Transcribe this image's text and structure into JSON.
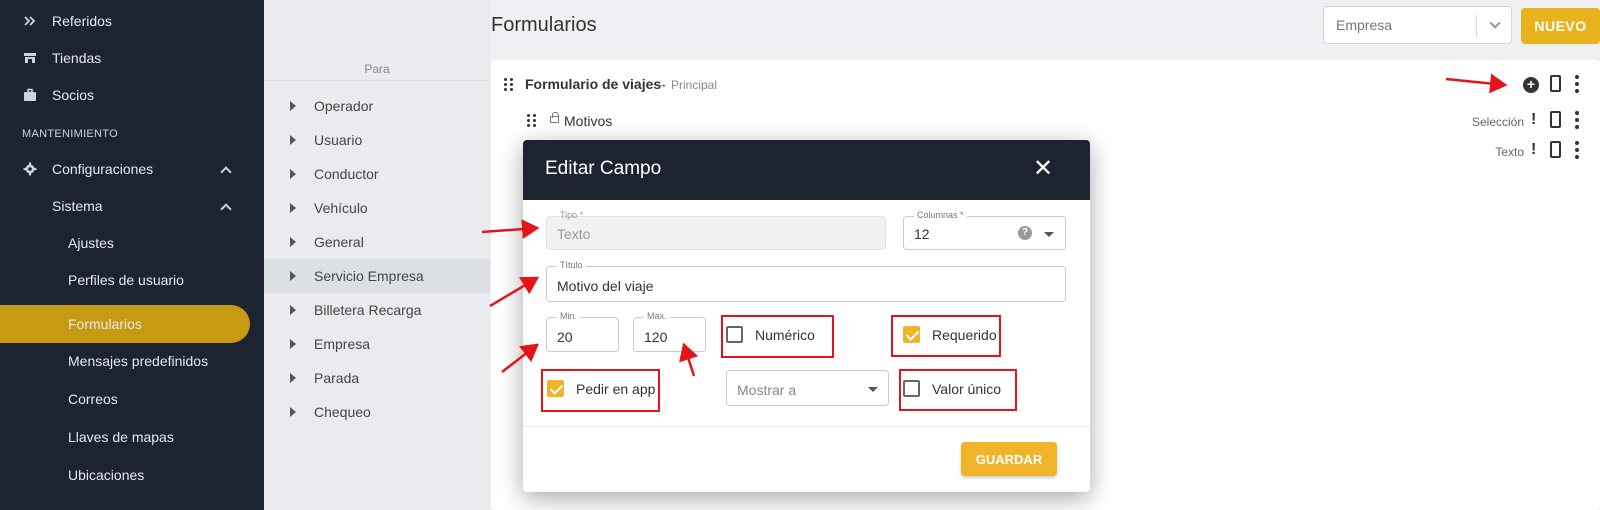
{
  "sidebar": {
    "items": [
      {
        "label": "Referidos",
        "icon": "referral-icon"
      },
      {
        "label": "Tiendas",
        "icon": "store-icon"
      },
      {
        "label": "Socios",
        "icon": "briefcase-icon"
      }
    ],
    "section_label": "MANTENIMIENTO",
    "configuraciones": "Configuraciones",
    "sistema": "Sistema",
    "sub_items": [
      "Ajustes",
      "Perfiles de usuario",
      "Formularios",
      "Mensajes predefinidos",
      "Correos",
      "Llaves de mapas",
      "Ubicaciones"
    ],
    "active": "Formularios",
    "accent_color": "#c79a14"
  },
  "tree": {
    "header": "Para",
    "items": [
      "Operador",
      "Usuario",
      "Conductor",
      "Vehículo",
      "General",
      "Servicio Empresa",
      "Billetera Recarga",
      "Empresa",
      "Parada",
      "Chequeo"
    ],
    "selected": "Servicio Empresa"
  },
  "header": {
    "title": "Formularios",
    "empresa_select": "Empresa",
    "nuevo_label": "NUEVO"
  },
  "form": {
    "name": "Formulario de viajes",
    "arrow": "→",
    "sub": "Principal",
    "rows": [
      {
        "label": "Motivos",
        "type": "Selección"
      },
      {
        "label": "",
        "type": "Texto"
      }
    ]
  },
  "modal": {
    "title": "Editar Campo",
    "close": "✕",
    "tipo": {
      "label": "Tipo *",
      "value": "Texto"
    },
    "columnas": {
      "label": "Columnas *",
      "value": "12"
    },
    "titulo": {
      "label": "Título",
      "value": "Motivo del viaje"
    },
    "min": {
      "label": "Min.",
      "value": "20"
    },
    "max": {
      "label": "Max.",
      "value": "120"
    },
    "numerico": {
      "label": "Numérico",
      "checked": false
    },
    "requerido": {
      "label": "Requerido",
      "checked": true
    },
    "pedir_en_app": {
      "label": "Pedir en app",
      "checked": true
    },
    "mostrar_a": {
      "placeholder": "Mostrar a"
    },
    "valor_unico": {
      "label": "Valor único",
      "checked": false
    },
    "guardar_label": "GUARDAR",
    "primary_color": "#f0b429"
  },
  "annotation_color": "#e3141b"
}
